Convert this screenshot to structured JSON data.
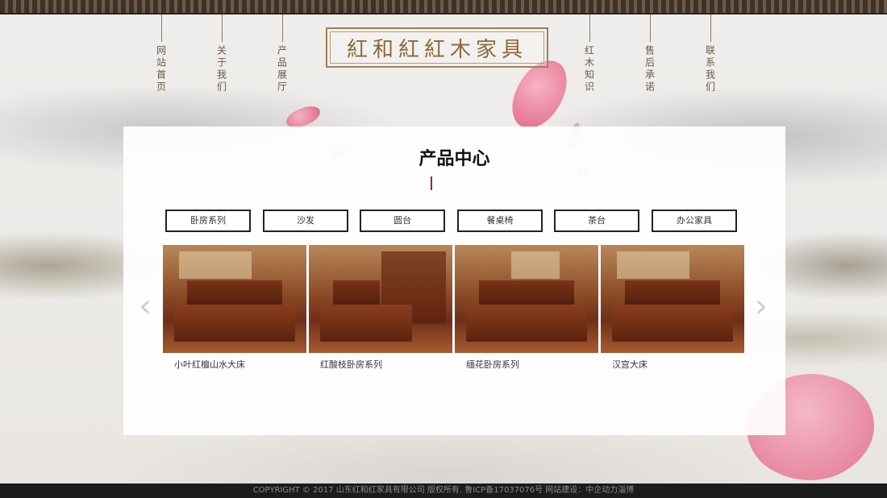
{
  "header": {
    "logo_text": "紅和紅紅木家具",
    "nav_left": [
      "网站首页",
      "关于我们",
      "产品展厅"
    ],
    "nav_right": [
      "红木知识",
      "售后承诺",
      "联系我们"
    ]
  },
  "main": {
    "title": "产品中心",
    "tabs": [
      "卧房系列",
      "沙发",
      "圆台",
      "餐桌椅",
      "茶台",
      "办公家具"
    ],
    "products": [
      {
        "caption": "小叶红檀山水大床"
      },
      {
        "caption": "红酸枝卧房系列"
      },
      {
        "caption": "缅花卧房系列"
      },
      {
        "caption": "汉宫大床"
      }
    ],
    "prev_arrow": "‹",
    "next_arrow": "›"
  },
  "footer": {
    "text": "COPYRIGHT © 2017  山东红和红家具有限公司  版权所有.  鲁ICP备17037076号    网站建设：中企动力淄博"
  },
  "colors": {
    "accent_red": "#b31b1b",
    "logo_gold": "#8a6a3a",
    "footer_bg": "#1c1c1c"
  }
}
